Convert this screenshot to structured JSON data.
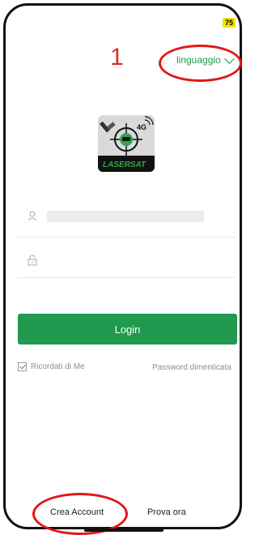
{
  "status": {
    "battery": "75"
  },
  "annotation": {
    "step_number": "1"
  },
  "header": {
    "language_label": "linguaggio"
  },
  "logo": {
    "brand_text": "LASERSAT",
    "badge": "4G"
  },
  "form": {
    "username_icon": "user-icon",
    "password_icon": "lock-icon",
    "login_label": "Login",
    "remember_label": "Ricordati di Me",
    "remember_checked": true,
    "forgot_label": "Password dimenticata"
  },
  "footer": {
    "create_account_label": "Crea Account",
    "try_now_label": "Prova ora"
  },
  "colors": {
    "accent": "#1f9a4e",
    "annotation": "#e01818"
  }
}
